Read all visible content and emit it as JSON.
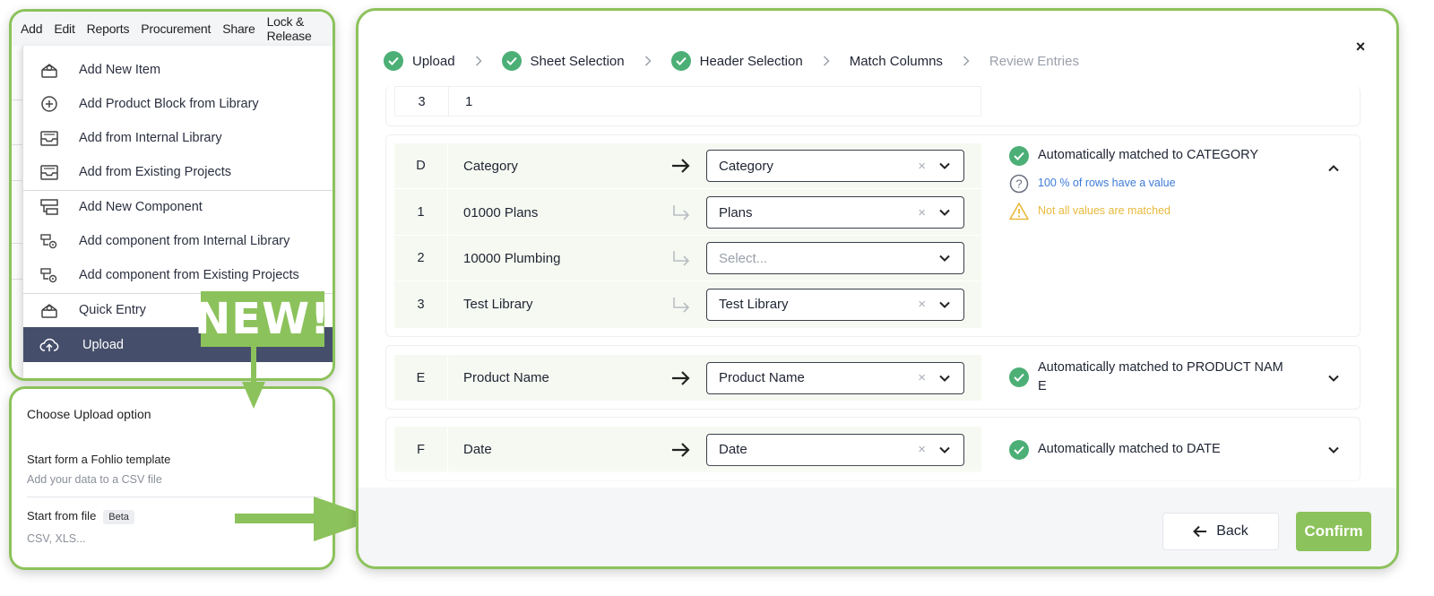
{
  "menubar": [
    "Add",
    "Edit",
    "Reports",
    "Procurement",
    "Share",
    "Lock & Release"
  ],
  "menu": {
    "items": [
      {
        "label": "Add New Item",
        "icon": "box-icon"
      },
      {
        "label": "Add Product Block from Library",
        "icon": "plus-circle-icon"
      },
      {
        "label": "Add from Internal Library",
        "icon": "inbox-icon"
      },
      {
        "label": "Add from Existing Projects",
        "icon": "inbox-icon"
      },
      {
        "label": "Add New Component",
        "icon": "component-icon"
      },
      {
        "label": "Add component from Internal Library",
        "icon": "component-small-icon"
      },
      {
        "label": "Add component from Existing Projects",
        "icon": "component-small-icon"
      },
      {
        "label": "Quick Entry",
        "icon": "box-icon"
      },
      {
        "label": "Upload",
        "icon": "cloud-upload-icon"
      }
    ],
    "new_badge": "NEW!"
  },
  "upload_options": {
    "title": "Choose Upload option",
    "option1_title": "Start form a Fohlio template",
    "option1_sub": "Add your data to a CSV file",
    "option2_title": "Start from file",
    "option2_badge": "Beta",
    "option2_sub": "CSV, XLS..."
  },
  "stepper": [
    {
      "label": "Upload",
      "done": true
    },
    {
      "label": "Sheet Selection",
      "done": true
    },
    {
      "label": "Header Selection",
      "done": true
    },
    {
      "label": "Match Columns",
      "done": false
    },
    {
      "label": "Review Entries",
      "done": false
    }
  ],
  "close_label": "×",
  "partial_row": {
    "index": "3",
    "value": "1"
  },
  "groups": {
    "D": {
      "letter": "D",
      "column": "Category",
      "match": "Category",
      "status": "Automatically matched to CATEGORY",
      "info": "100 % of rows have a value",
      "warning": "Not all values are matched",
      "rows": [
        {
          "index": "1",
          "value": "01000 Plans",
          "match": "Plans"
        },
        {
          "index": "2",
          "value": "10000 Plumbing",
          "match": "Select..."
        },
        {
          "index": "3",
          "value": "Test Library",
          "match": "Test Library"
        }
      ]
    },
    "E": {
      "letter": "E",
      "column": "Product Name",
      "match": "Product Name",
      "status_line1": "Automatically matched to PRODUCT NAM",
      "status_line2": "E"
    },
    "F": {
      "letter": "F",
      "column": "Date",
      "match": "Date",
      "status": "Automatically matched to DATE"
    }
  },
  "clear_glyph": "×",
  "footer": {
    "back": "Back",
    "confirm": "Confirm"
  },
  "colors": {
    "accent_green": "#8cc25b",
    "check_green": "#4caf76",
    "active_menu": "#454f6b",
    "info_blue": "#3d7bd9",
    "warn_yellow": "#e8b93c"
  }
}
